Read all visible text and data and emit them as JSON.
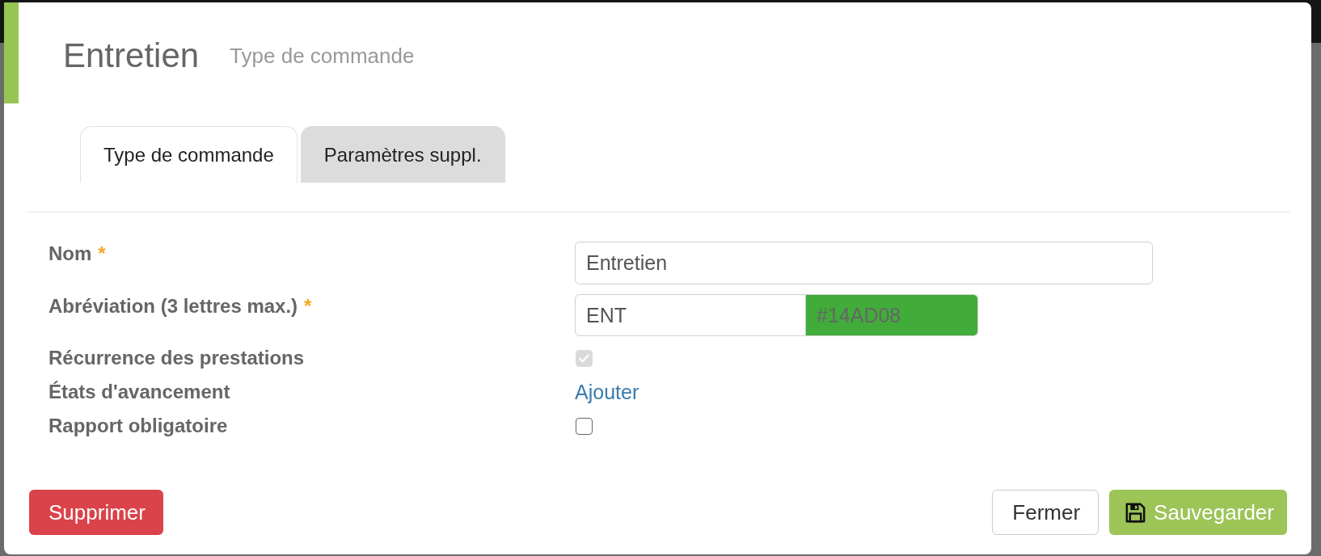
{
  "modal": {
    "title": "Entretien",
    "subtitle": "Type de commande"
  },
  "tabs": [
    {
      "label": "Type de commande",
      "selected": true
    },
    {
      "label": "Paramètres suppl.",
      "selected": false
    }
  ],
  "fields": [
    {
      "kind": "text",
      "label": "Nom",
      "required_mark": "*",
      "value": "Entretien"
    },
    {
      "kind": "text_color",
      "label": "Abréviation (3 lettres max.)",
      "required_mark": "*",
      "value": "ENT",
      "color_value": "#14AD08"
    },
    {
      "kind": "checkbox",
      "label": "Récurrence des prestations",
      "checked": true,
      "disabled": true
    },
    {
      "kind": "link",
      "label": "États d'avancement",
      "link": "Ajouter"
    },
    {
      "kind": "checkbox",
      "label": "Rapport obligatoire",
      "checked": false,
      "disabled": false
    }
  ],
  "buttons": [
    {
      "kind": "danger",
      "label": "Supprimer"
    },
    {
      "kind": "default",
      "label": "Fermer"
    },
    {
      "kind": "save",
      "label": "Sauvegarder"
    }
  ]
}
